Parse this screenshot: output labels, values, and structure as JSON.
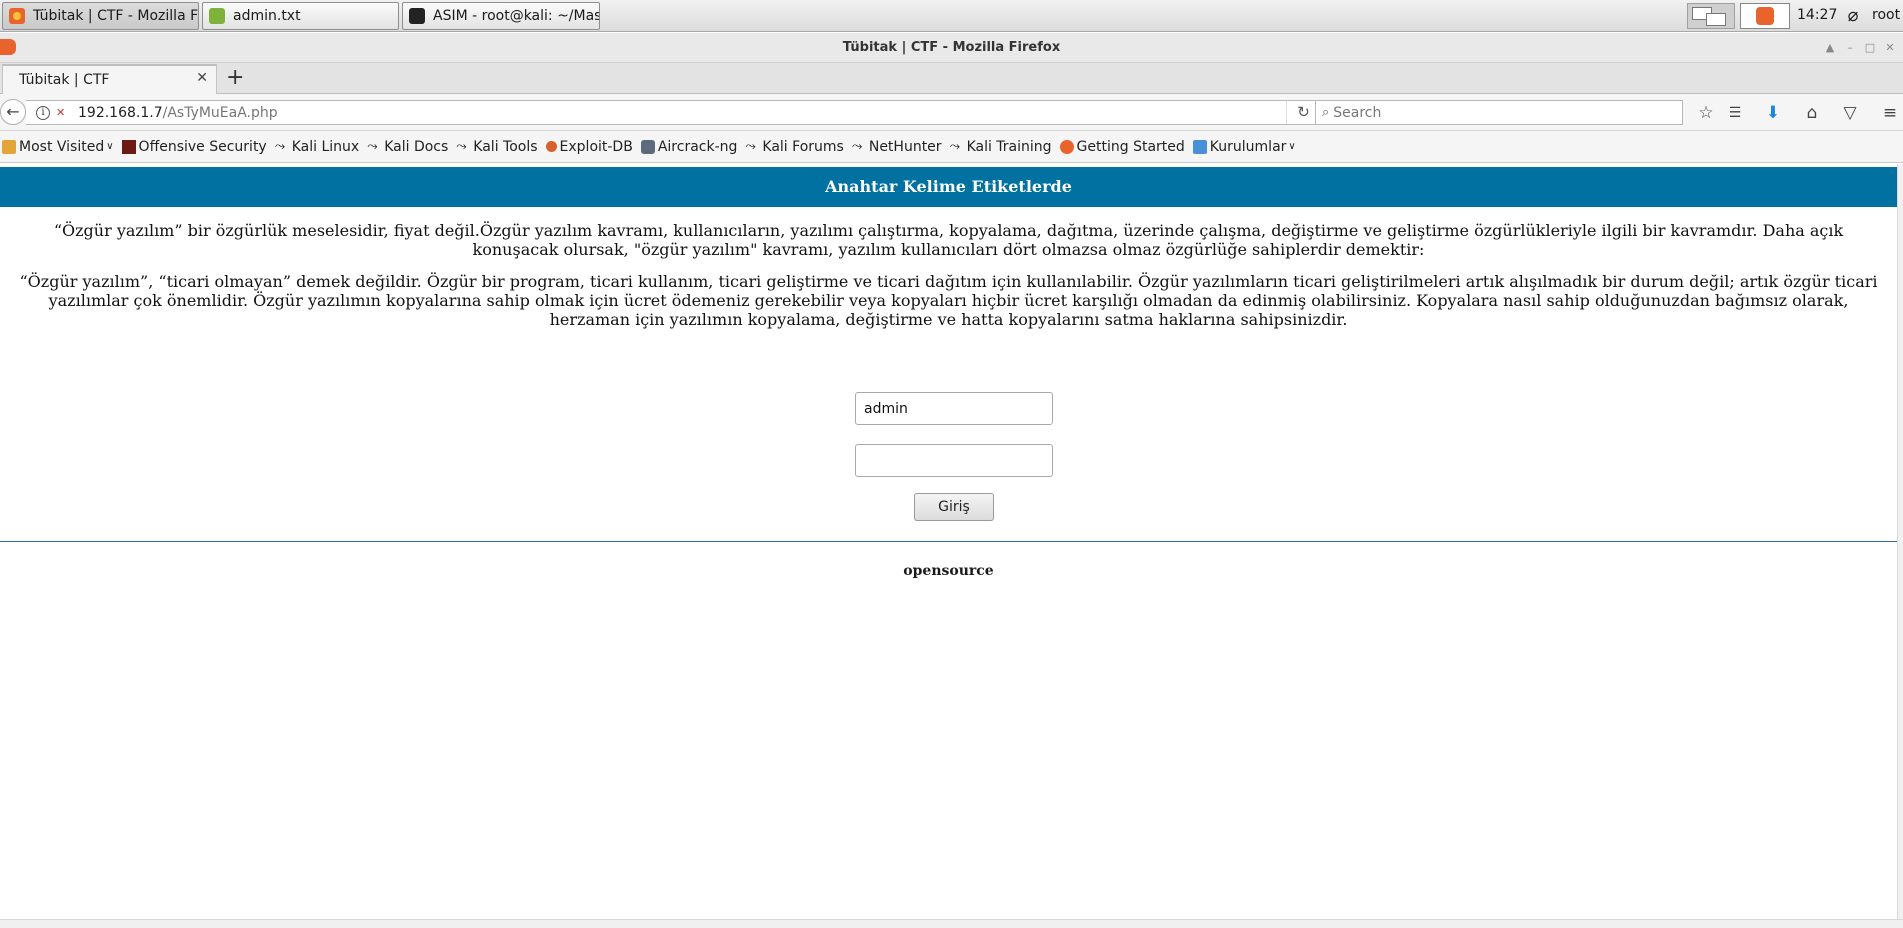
{
  "taskbar": {
    "tasks": [
      {
        "label": "Tübitak | CTF - Mozilla Fi...",
        "icon": "firefox-icon"
      },
      {
        "label": "admin.txt",
        "icon": "text-editor-icon"
      },
      {
        "label": "ASIM - root@kali: ~/Mas...",
        "icon": "terminal-icon"
      }
    ],
    "clock": "14:27",
    "user": "root"
  },
  "window": {
    "title": "Tübitak | CTF - Mozilla Firefox"
  },
  "tab": {
    "title": "Tübitak | CTF"
  },
  "navbar": {
    "url_host": "192.168.1.7",
    "url_path": "/AsTyMuEaA.php",
    "search_placeholder": "Search"
  },
  "bookmarks": [
    {
      "label": "Most Visited",
      "icon": "folder-icon",
      "dropdown": true
    },
    {
      "label": "Offensive Security",
      "icon": "offsec-icon"
    },
    {
      "label": "Kali Linux",
      "icon": "kali-dragon-icon"
    },
    {
      "label": "Kali Docs",
      "icon": "kali-dragon-icon"
    },
    {
      "label": "Kali Tools",
      "icon": "kali-dragon-icon"
    },
    {
      "label": "Exploit-DB",
      "icon": "exploit-db-icon"
    },
    {
      "label": "Aircrack-ng",
      "icon": "aircrack-icon"
    },
    {
      "label": "Kali Forums",
      "icon": "kali-dragon-icon"
    },
    {
      "label": "NetHunter",
      "icon": "kali-dragon-icon"
    },
    {
      "label": "Kali Training",
      "icon": "kali-dragon-icon"
    },
    {
      "label": "Getting Started",
      "icon": "firefox-icon"
    },
    {
      "label": "Kurulumlar",
      "icon": "folder-icon",
      "dropdown": true
    }
  ],
  "page": {
    "header": "Anahtar Kelime Etiketlerde",
    "paragraph1": "“Özgür yazılım” bir özgürlük meselesidir, fiyat değil.Özgür yazılım kavramı, kullanıcıların, yazılımı çalıştırma, kopyalama, dağıtma, üzerinde çalışma, değiştirme ve geliştirme özgürlükleriyle ilgili bir kavramdır. Daha açık konuşacak olursak, \"özgür yazılım\" kavramı, yazılım kullanıcıları dört olmazsa olmaz özgürlüğe sahiplerdir demektir:",
    "paragraph2": "“Özgür yazılım”, “ticari olmayan” demek değildir. Özgür bir program, ticari kullanım, ticari geliştirme ve ticari dağıtım için kullanılabilir. Özgür yazılımların ticari geliştirilmeleri artık alışılmadık bir durum değil; artık özgür ticari yazılımlar çok önemlidir. Özgür yazılımın kopyalarına sahip olmak için ücret ödemeniz gerekebilir veya kopyaları hiçbir ücret karşılığı olmadan da edinmiş olabilirsiniz. Kopyalara nasıl sahip olduğunuzdan bağımsız olarak, herzaman için yazılımın kopyalama, değiştirme ve hatta kopyalarını satma haklarına sahipsinizdir.",
    "username_value": "admin",
    "password_value": "",
    "login_button": "Giriş",
    "footer": "opensource"
  },
  "colors": {
    "header_bg": "#0071a1",
    "divider": "#2a6f9c"
  }
}
